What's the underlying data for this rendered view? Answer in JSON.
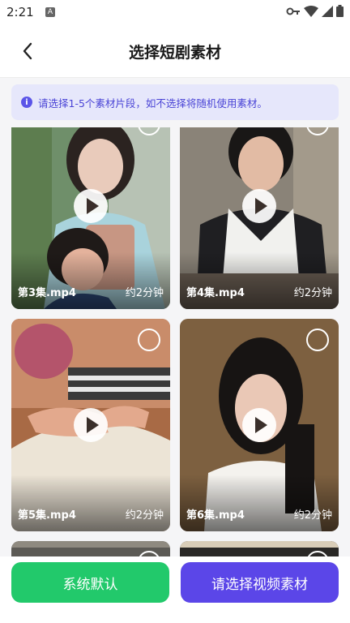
{
  "status_bar": {
    "time": "2:21",
    "notif_letter": "A"
  },
  "header": {
    "title": "选择短剧素材"
  },
  "notice": {
    "icon": "info-icon",
    "text": "请选择1-5个素材片段，如不选择将随机使用素材。"
  },
  "clips": [
    {
      "title": "第3集.mp4",
      "duration": "约2分钟"
    },
    {
      "title": "第4集.mp4",
      "duration": "约2分钟"
    },
    {
      "title": "第5集.mp4",
      "duration": "约2分钟"
    },
    {
      "title": "第6集.mp4",
      "duration": "约2分钟"
    }
  ],
  "buttons": {
    "default_label": "系统默认",
    "select_label": "请选择视频素材"
  },
  "colors": {
    "accent": "#5b46e8",
    "green": "#22c96b",
    "notice_bg": "#e6e7fb"
  }
}
